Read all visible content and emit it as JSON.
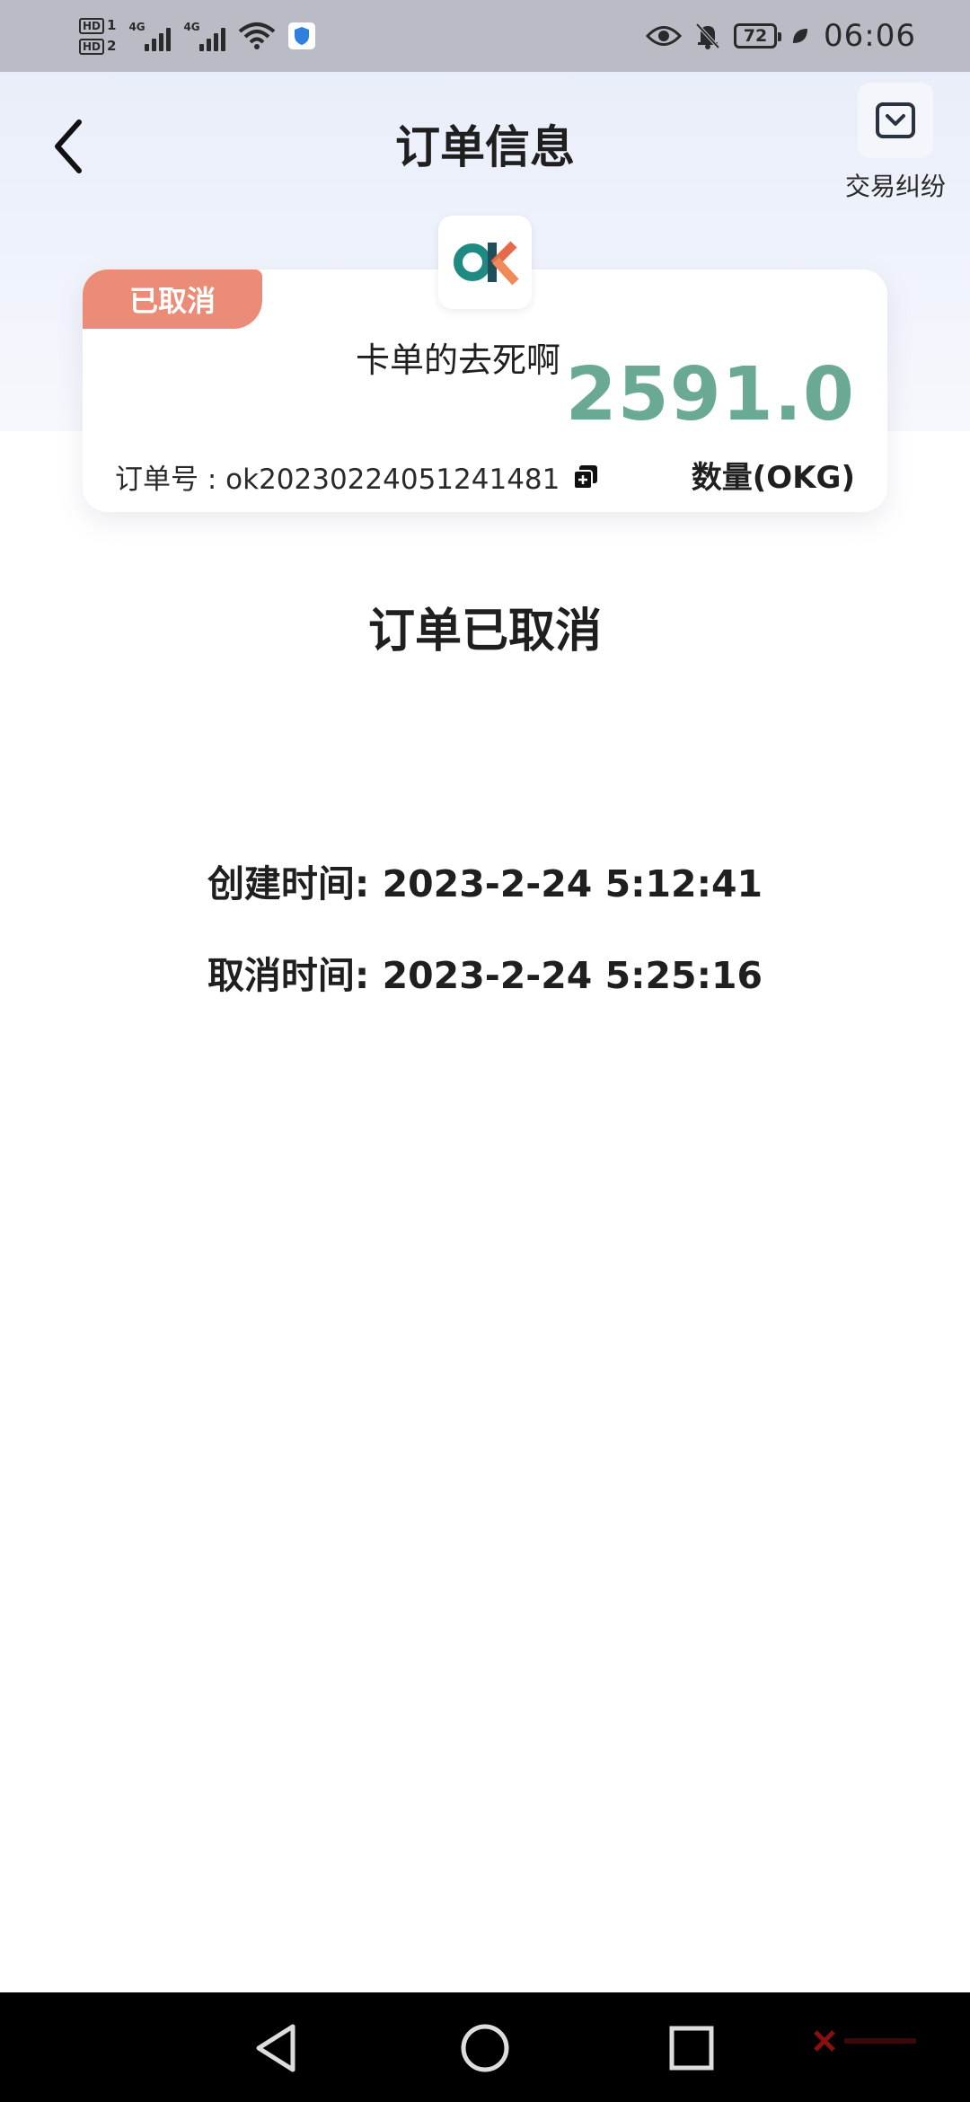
{
  "status_bar": {
    "hd1": "HD",
    "hd1_sim": "1",
    "hd2": "HD",
    "hd2_sim": "2",
    "net1": "4G",
    "net2": "4G",
    "battery": "72",
    "time": "06:06"
  },
  "header": {
    "title": "订单信息",
    "dispute_label": "交易纠纷"
  },
  "card": {
    "badge": "已取消",
    "merchant_name": "卡单的去死啊",
    "amount": "2591.0",
    "order_no": "订单号 : ok20230224051241481",
    "qty_label": "数量(OKG)"
  },
  "status": {
    "heading": "订单已取消",
    "created": "创建时间: 2023-2-24 5:12:41",
    "cancelled": "取消时间: 2023-2-24 5:25:16"
  },
  "colors": {
    "badge": "#ea8c78",
    "amount": "#6aaa94",
    "nav_bar": "#000000"
  },
  "icons": [
    "back-arrow-icon",
    "dispute-icon",
    "copy-icon",
    "okx-logo-icon",
    "nav-back-icon",
    "nav-home-icon",
    "nav-recents-icon",
    "eye-icon",
    "bell-muted-icon",
    "battery-icon",
    "wifi-icon",
    "shield-icon"
  ]
}
